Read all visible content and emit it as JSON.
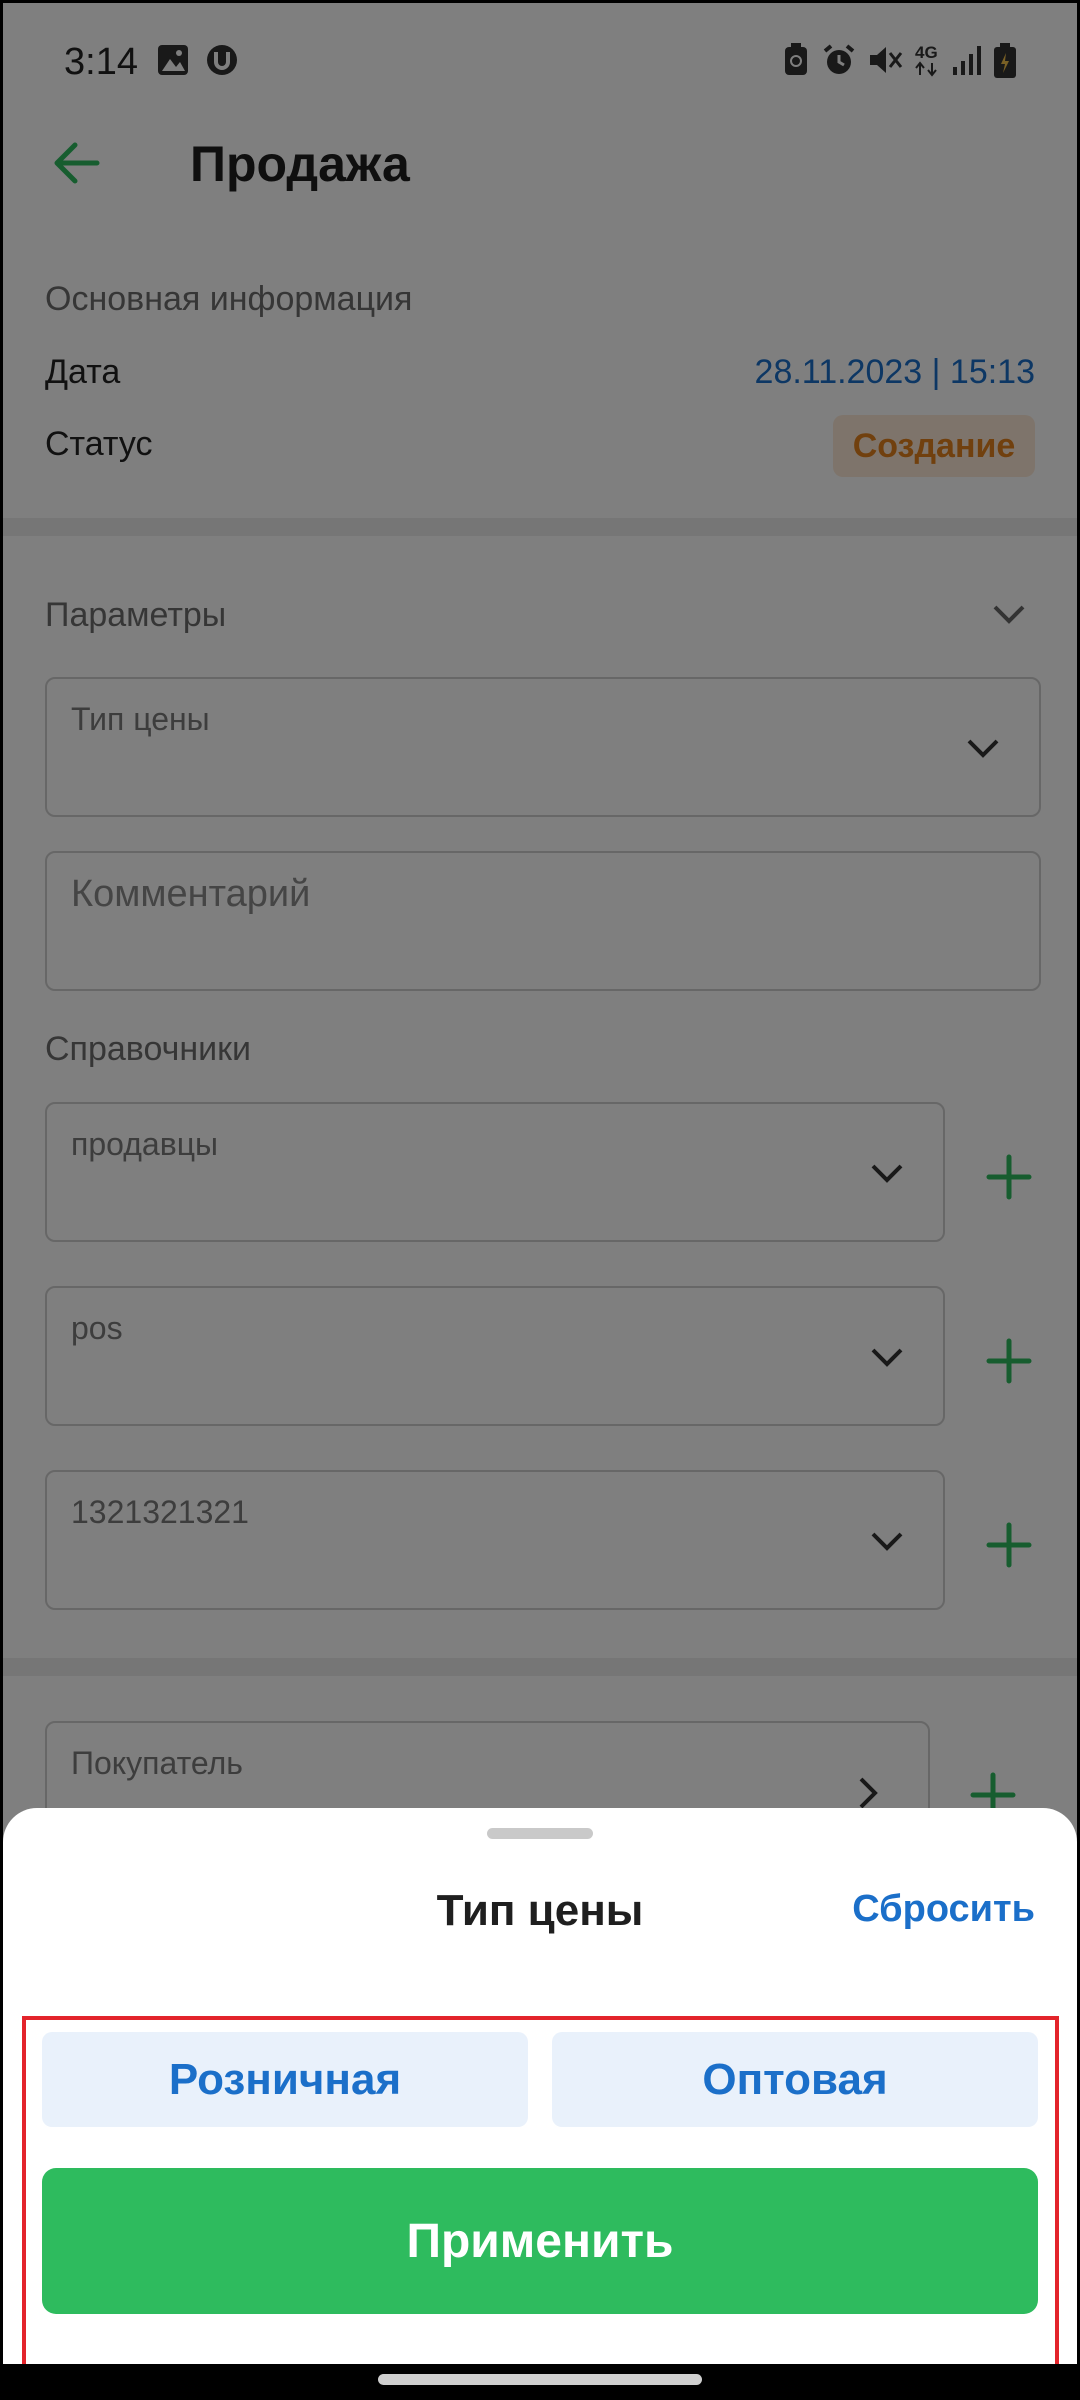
{
  "status_bar": {
    "time": "3:14",
    "network": "4G"
  },
  "header": {
    "title": "Продажа"
  },
  "basic_info": {
    "section_title": "Основная информация",
    "date_label": "Дата",
    "date_value": "28.11.2023 | 15:13",
    "status_label": "Статус",
    "status_value": "Создание"
  },
  "params": {
    "section_title": "Параметры",
    "price_type_label": "Тип цены",
    "comment_placeholder": "Комментарий"
  },
  "directories": {
    "section_title": "Справочники",
    "fields": [
      {
        "label": "продавцы"
      },
      {
        "label": "pos"
      },
      {
        "label": "1321321321"
      }
    ]
  },
  "buyer": {
    "label": "Покупатель"
  },
  "sheet": {
    "title": "Тип цены",
    "reset_label": "Сбросить",
    "options": [
      "Розничная",
      "Оптовая"
    ],
    "apply_label": "Применить"
  },
  "colors": {
    "accent_green": "#2ebb5e",
    "link_blue": "#1b6fc9",
    "status_orange": "#e2801c",
    "highlight_red": "#e3242b"
  }
}
